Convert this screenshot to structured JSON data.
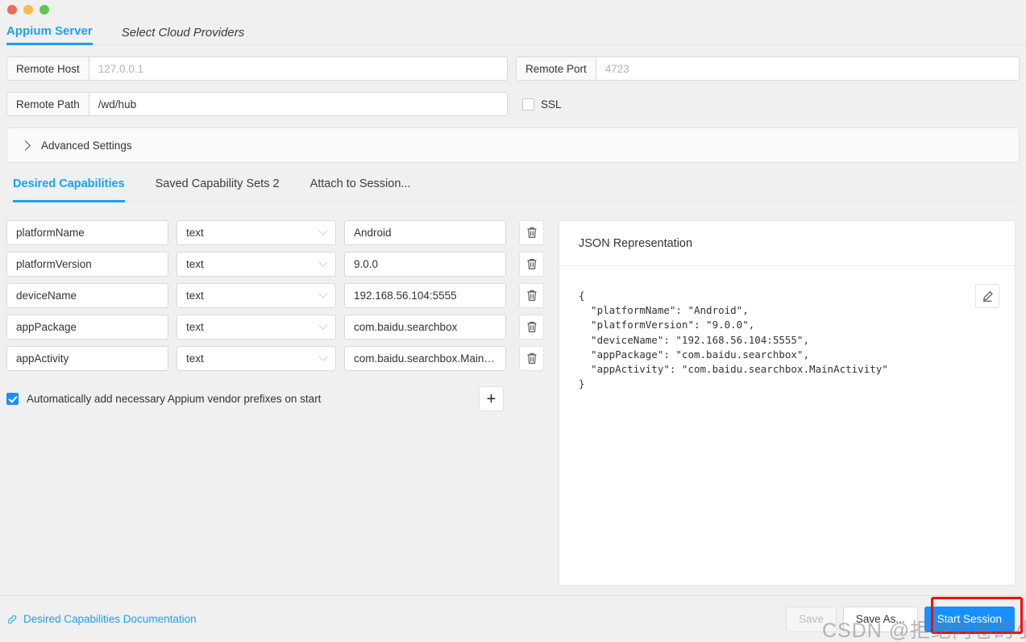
{
  "window": {
    "traffic_lights": [
      "close",
      "minimize",
      "maximize"
    ]
  },
  "server_tabs": [
    {
      "label": "Appium Server",
      "active": true
    },
    {
      "label": "Select Cloud Providers",
      "active": false
    }
  ],
  "server_config": {
    "remote_host": {
      "label": "Remote Host",
      "value": "",
      "placeholder": "127.0.0.1"
    },
    "remote_port": {
      "label": "Remote Port",
      "value": "",
      "placeholder": "4723"
    },
    "remote_path": {
      "label": "Remote Path",
      "value": "/wd/hub",
      "placeholder": "/wd/hub"
    },
    "ssl": {
      "label": "SSL",
      "checked": false
    },
    "advanced_settings": {
      "label": "Advanced Settings",
      "expanded": false
    }
  },
  "cap_tabs": [
    {
      "label": "Desired Capabilities",
      "active": true
    },
    {
      "label": "Saved Capability Sets 2",
      "active": false
    },
    {
      "label": "Attach to Session...",
      "active": false
    }
  ],
  "capabilities": {
    "rows": [
      {
        "name": "platformName",
        "type": "text",
        "value": "Android"
      },
      {
        "name": "platformVersion",
        "type": "text",
        "value": "9.0.0"
      },
      {
        "name": "deviceName",
        "type": "text",
        "value": "192.168.56.104:5555"
      },
      {
        "name": "appPackage",
        "type": "text",
        "value": "com.baidu.searchbox"
      },
      {
        "name": "appActivity",
        "type": "text",
        "value": "com.baidu.searchbox.MainActivity"
      }
    ],
    "auto_prefix": {
      "label": "Automatically add necessary Appium vendor prefixes on start",
      "checked": true
    },
    "add_button_label": "+"
  },
  "json_panel": {
    "title": "JSON Representation",
    "text": "{\n  \"platformName\": \"Android\",\n  \"platformVersion\": \"9.0.0\",\n  \"deviceName\": \"192.168.56.104:5555\",\n  \"appPackage\": \"com.baidu.searchbox\",\n  \"appActivity\": \"com.baidu.searchbox.MainActivity\"\n}"
  },
  "footer": {
    "doc_link": "Desired Capabilities Documentation",
    "save_label": "Save",
    "save_as_label": "Save As...",
    "start_session_label": "Start Session"
  },
  "watermark": "CSDN @拒绝内卷的小测试",
  "colors": {
    "accent": "#1ba1f2",
    "primary_button": "#1890ff",
    "highlight_box": "#ff0000",
    "page_background": "#f0f0f0"
  }
}
